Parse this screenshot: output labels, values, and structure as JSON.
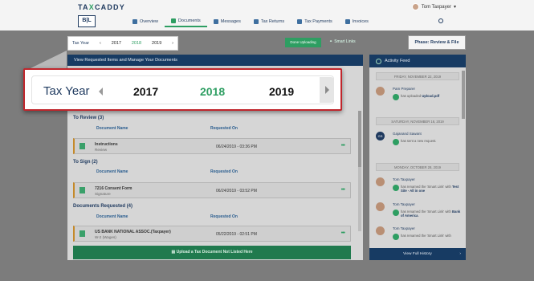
{
  "header": {
    "logo_prefix": "TA",
    "logo_accent": "X",
    "logo_suffix": "CADDY",
    "brand_box": "B|L",
    "user_name": "Tom Taxpayer",
    "nav": [
      {
        "label": "Overview",
        "icon": "home-icon"
      },
      {
        "label": "Documents",
        "icon": "documents-icon"
      },
      {
        "label": "Messages",
        "icon": "messages-icon"
      },
      {
        "label": "Tax Returns",
        "icon": "tax-returns-icon"
      },
      {
        "label": "Tax Payments",
        "icon": "tax-payments-icon"
      },
      {
        "label": "Invoices",
        "icon": "invoices-icon"
      }
    ]
  },
  "tax_year_small": {
    "label": "Tax Year",
    "years": [
      "2017",
      "2018",
      "2019"
    ],
    "selected": "2018"
  },
  "toolbar": {
    "done_label": "Done Uploading",
    "smart_links_label": "Smart Links",
    "phase_label": "Phase: Review & File"
  },
  "main": {
    "header": "View Requested Items and Manage Your Documents",
    "sections": [
      {
        "title": "To Review",
        "count": "(3)",
        "col_name": "Document Name",
        "col_date": "Requested On",
        "rows": [
          {
            "name": "Instructions",
            "sub": "Review",
            "date": "06/24/2019 - 03:36 PM"
          }
        ]
      },
      {
        "title": "To Sign",
        "count": "(2)",
        "col_name": "Document Name",
        "col_date": "Requested On",
        "rows": [
          {
            "name": "7216 Consent Form",
            "sub": "Signature",
            "date": "06/24/2019 - 03:52 PM"
          }
        ]
      },
      {
        "title": "Documents Requested",
        "count": "(4)",
        "col_name": "Document Name",
        "col_date": "Requested On",
        "rows": [
          {
            "name": "US BANK NATIONAL ASSOC.(Taxpayer)",
            "sub": "W-2 (Wages)",
            "date": "05/22/2019 - 02:51 PM"
          }
        ]
      }
    ],
    "upload_label": "Upload a Tax Document Not Listed Here"
  },
  "feed": {
    "title": "Activity Feed",
    "footer": "View Full History",
    "dates": [
      "FRIDAY, NOVEMBER 22, 2019",
      "SATURDAY, NOVEMBER 16, 2019",
      "MONDAY, OCTOBER 28, 2019"
    ],
    "items": [
      {
        "who": "Pam Preparer",
        "msg_pre": "has uploaded ",
        "msg_bold": "Upload.pdf",
        "msg_post": ""
      },
      {
        "who": "Gajanand Sawant",
        "initials": "GS",
        "msg_pre": "has sent a new request.",
        "msg_bold": "",
        "msg_post": ""
      },
      {
        "who": "Tom Taxpayer",
        "msg_pre": "has renamed the 'Smart Link' with ",
        "msg_bold": "Test Site - All in one",
        "msg_post": ""
      },
      {
        "who": "Tom Taxpayer",
        "msg_pre": "has renamed the 'Smart Link' with ",
        "msg_bold": "Bank of America",
        "msg_post": "."
      },
      {
        "who": "Tom Taxpayer",
        "msg_pre": "has renamed the 'Smart Link' with ",
        "msg_bold": "",
        "msg_post": ""
      }
    ]
  },
  "callout": {
    "label": "Tax Year",
    "years": [
      "2017",
      "2018",
      "2019"
    ],
    "selected": "2018"
  }
}
